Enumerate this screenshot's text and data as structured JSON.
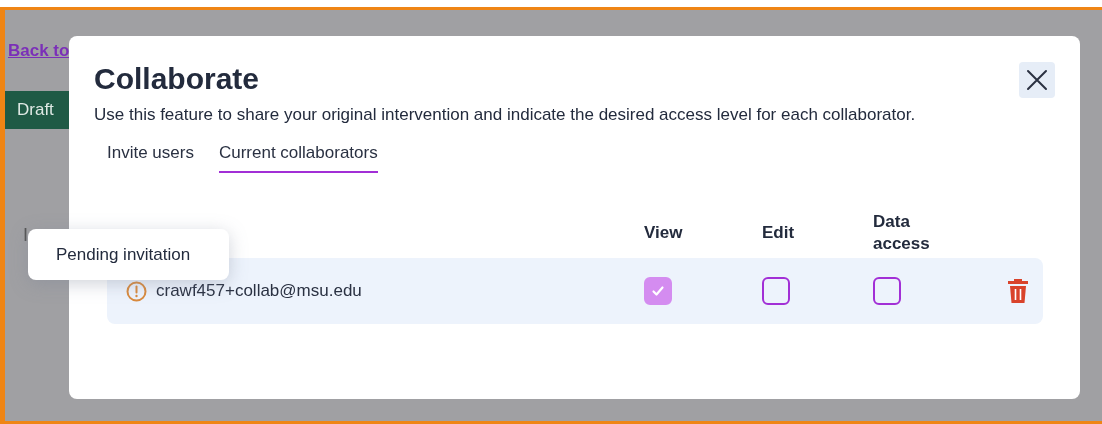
{
  "background": {
    "back_link": "Back to",
    "status_badge": "Draft",
    "partial_label": "I"
  },
  "dialog": {
    "title": "Collaborate",
    "description": "Use this feature to share your original intervention and indicate the desired access level for each collaborator.",
    "tabs": [
      {
        "label": "Invite users",
        "selected": false
      },
      {
        "label": "Current collaborators",
        "selected": true
      }
    ],
    "columns": [
      "View",
      "Edit",
      "Data access"
    ],
    "collaborators": [
      {
        "email": "crawf457+collab@msu.edu",
        "pending": true,
        "view": true,
        "edit": false,
        "data_access": false
      }
    ]
  },
  "tooltip": {
    "text": "Pending invitation"
  }
}
